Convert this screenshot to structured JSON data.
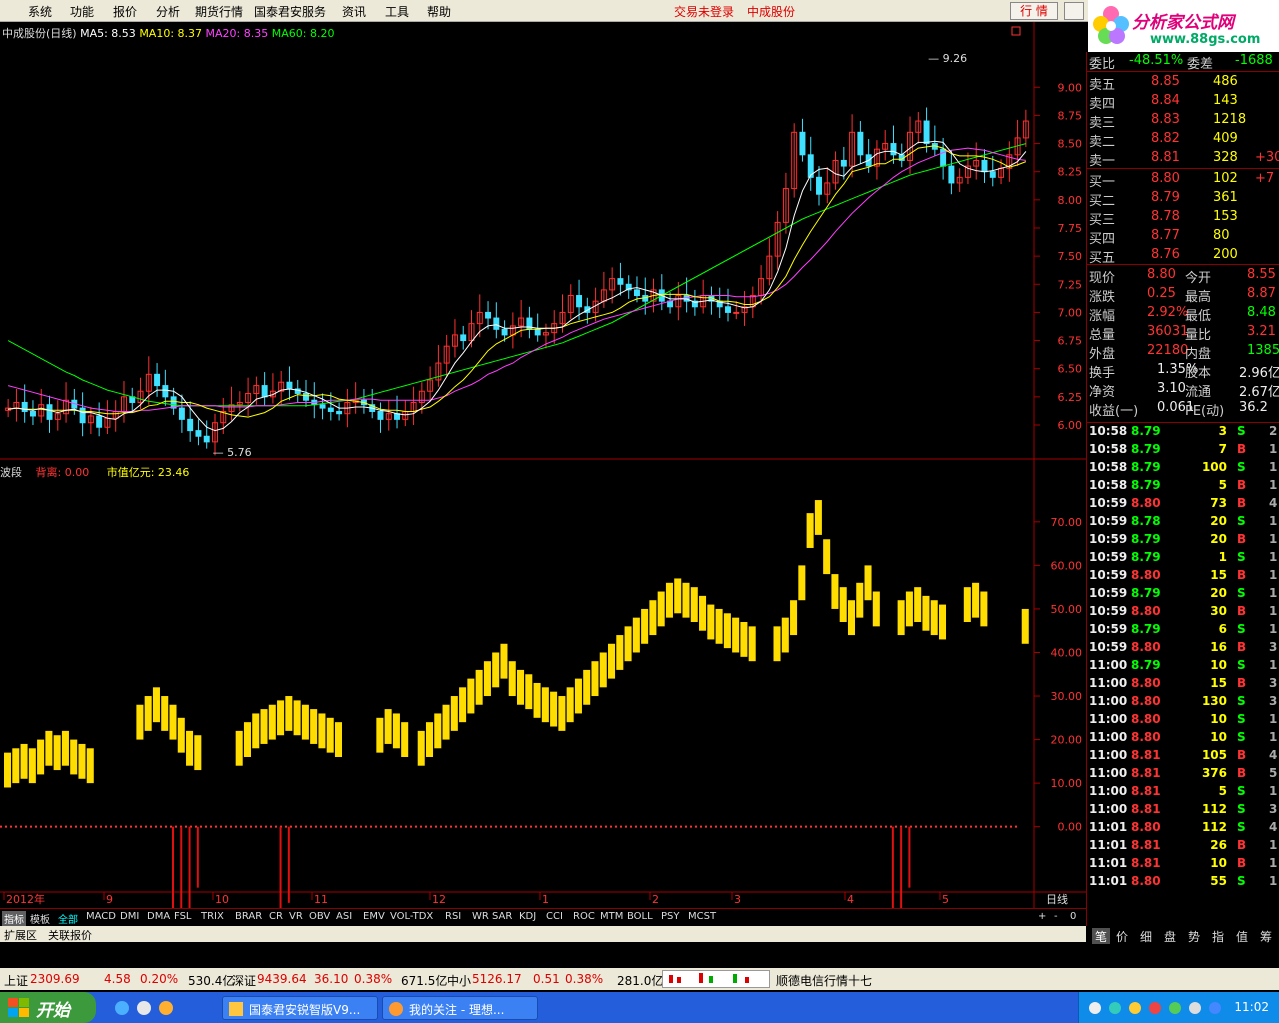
{
  "menu": {
    "items": [
      "系统",
      "功能",
      "报价",
      "分析",
      "期货行情",
      "国泰君安服务",
      "资讯",
      "工具",
      "帮助"
    ],
    "login_status": "交易未登录",
    "stock_name": "中成股份",
    "quote_button": "行 情"
  },
  "logo": {
    "text": "分析家公式网",
    "url": "www.88gs.com"
  },
  "main_chart": {
    "title": "中成股份(日线)",
    "ma5": "MA5: 8.53",
    "ma10": "MA10: 8.37",
    "ma20": "MA20: 8.35",
    "ma60": "MA60: 8.20",
    "high_label": "9.26",
    "low_label": "5.76"
  },
  "indicator": {
    "name": "波段",
    "item1": "背离: 0.00",
    "item2": "市值亿元: 23.46"
  },
  "colors": {
    "up": "#ff3030",
    "down": "#40e0ff",
    "ma5": "#ffffff",
    "ma10": "#ffff00",
    "ma20": "#ff40ff",
    "ma60": "#00ff00",
    "wave": "#ffdd00"
  },
  "chart_data": [
    {
      "type": "candlestick",
      "axis_ticks": [
        "9.00",
        "8.75",
        "8.50",
        "8.25",
        "8.00",
        "7.75",
        "7.50",
        "7.25",
        "7.00",
        "6.75",
        "6.50",
        "6.25",
        "6.00"
      ],
      "ylim": [
        5.76,
        9.26
      ],
      "x_labels": [
        "2012年",
        "9",
        "10",
        "11",
        "12",
        "1",
        "2",
        "3",
        "4",
        "5"
      ],
      "period": "日线",
      "close": [
        6.15,
        6.2,
        6.12,
        6.08,
        6.18,
        6.05,
        6.1,
        6.22,
        6.15,
        6.02,
        6.08,
        5.98,
        6.06,
        6.12,
        6.25,
        6.2,
        6.3,
        6.45,
        6.35,
        6.25,
        6.15,
        6.05,
        5.95,
        5.9,
        5.85,
        6.02,
        6.12,
        6.18,
        6.2,
        6.28,
        6.35,
        6.25,
        6.3,
        6.38,
        6.32,
        6.28,
        6.22,
        6.18,
        6.15,
        6.12,
        6.1,
        6.2,
        6.22,
        6.18,
        6.12,
        6.05,
        6.1,
        6.05,
        6.12,
        6.2,
        6.3,
        6.4,
        6.55,
        6.7,
        6.8,
        6.75,
        6.9,
        7.0,
        6.95,
        6.85,
        6.8,
        6.88,
        6.95,
        6.85,
        6.8,
        6.82,
        6.9,
        7.0,
        7.15,
        7.05,
        7.0,
        7.1,
        7.2,
        7.3,
        7.25,
        7.2,
        7.15,
        7.1,
        7.2,
        7.1,
        7.05,
        7.15,
        7.1,
        7.05,
        7.15,
        7.1,
        7.05,
        7.0,
        7.0,
        7.05,
        7.15,
        7.3,
        7.5,
        7.8,
        8.1,
        8.6,
        8.4,
        8.2,
        8.05,
        8.15,
        8.35,
        8.3,
        8.6,
        8.4,
        8.3,
        8.45,
        8.5,
        8.4,
        8.35,
        8.6,
        8.7,
        8.5,
        8.45,
        8.3,
        8.15,
        8.2,
        8.3,
        8.35,
        8.25,
        8.2,
        8.28,
        8.4,
        8.55,
        8.7
      ],
      "ma5": [
        6.14,
        6.15,
        6.14,
        6.13,
        6.15,
        6.13,
        6.11,
        6.13,
        6.14,
        6.11,
        6.11,
        6.09,
        6.06,
        6.05,
        6.1,
        6.12,
        6.18,
        6.26,
        6.31,
        6.31,
        6.3,
        6.25,
        6.15,
        6.06,
        5.98,
        5.95,
        5.97,
        6.03,
        6.11,
        6.16,
        6.23,
        6.25,
        6.27,
        6.31,
        6.32,
        6.31,
        6.29,
        6.26,
        6.23,
        6.19,
        6.15,
        6.15,
        6.16,
        6.16,
        6.15,
        6.13,
        6.12,
        6.1,
        6.09,
        6.1,
        6.15,
        6.21,
        6.31,
        6.43,
        6.55,
        6.64,
        6.74,
        6.83,
        6.88,
        6.89,
        6.86,
        6.86,
        6.87,
        6.87,
        6.86,
        6.86,
        6.86,
        6.87,
        6.93,
        6.98,
        7.02,
        7.06,
        7.1,
        7.13,
        7.17,
        7.21,
        7.22,
        7.2,
        7.18,
        7.15,
        7.12,
        7.12,
        7.12,
        7.09,
        7.1,
        7.11,
        7.09,
        7.08,
        7.06,
        7.04,
        7.05,
        7.1,
        7.2,
        7.36,
        7.57,
        7.86,
        8.08,
        8.22,
        8.27,
        8.28,
        8.23,
        8.21,
        8.29,
        8.32,
        8.35,
        8.41,
        8.43,
        8.43,
        8.4,
        8.46,
        8.51,
        8.51,
        8.52,
        8.51,
        8.42,
        8.32,
        8.28,
        8.26,
        8.25,
        8.26,
        8.28,
        8.3,
        8.34,
        8.43
      ],
      "ma10": [
        6.14,
        6.15,
        6.14,
        6.14,
        6.14,
        6.13,
        6.13,
        6.13,
        6.13,
        6.12,
        6.12,
        6.11,
        6.1,
        6.1,
        6.11,
        6.11,
        6.13,
        6.17,
        6.18,
        6.21,
        6.21,
        6.2,
        6.2,
        6.18,
        6.15,
        6.13,
        6.11,
        6.09,
        6.08,
        6.07,
        6.09,
        6.11,
        6.15,
        6.21,
        6.24,
        6.27,
        6.26,
        6.26,
        6.27,
        6.26,
        6.23,
        6.22,
        6.21,
        6.2,
        6.17,
        6.14,
        6.13,
        6.13,
        6.12,
        6.12,
        6.14,
        6.16,
        6.21,
        6.27,
        6.34,
        6.4,
        6.48,
        6.57,
        6.66,
        6.72,
        6.76,
        6.8,
        6.84,
        6.85,
        6.85,
        6.86,
        6.86,
        6.87,
        6.9,
        6.92,
        6.94,
        6.96,
        6.98,
        7.0,
        7.04,
        7.09,
        7.12,
        7.13,
        7.15,
        7.16,
        7.16,
        7.16,
        7.16,
        7.14,
        7.13,
        7.13,
        7.1,
        7.1,
        7.09,
        7.07,
        7.07,
        7.1,
        7.14,
        7.22,
        7.32,
        7.47,
        7.6,
        7.72,
        7.83,
        7.94,
        8.05,
        8.14,
        8.25,
        8.27,
        8.29,
        8.32,
        8.32,
        8.36,
        8.36,
        8.41,
        8.46,
        8.47,
        8.48,
        8.46,
        8.41,
        8.39,
        8.39,
        8.39,
        8.38,
        8.36,
        8.33,
        8.29,
        8.31,
        8.34
      ],
      "ma20": [
        6.35,
        6.33,
        6.31,
        6.29,
        6.27,
        6.25,
        6.23,
        6.21,
        6.19,
        6.17,
        6.15,
        6.14,
        6.13,
        6.12,
        6.12,
        6.12,
        6.13,
        6.13,
        6.14,
        6.15,
        6.16,
        6.17,
        6.17,
        6.17,
        6.17,
        6.17,
        6.16,
        6.16,
        6.16,
        6.16,
        6.17,
        6.17,
        6.17,
        6.18,
        6.19,
        6.2,
        6.2,
        6.2,
        6.21,
        6.22,
        6.22,
        6.22,
        6.23,
        6.23,
        6.23,
        6.22,
        6.22,
        6.22,
        6.22,
        6.22,
        6.22,
        6.22,
        6.24,
        6.26,
        6.3,
        6.33,
        6.36,
        6.4,
        6.45,
        6.48,
        6.52,
        6.55,
        6.6,
        6.64,
        6.68,
        6.72,
        6.75,
        6.78,
        6.82,
        6.85,
        6.88,
        6.91,
        6.94,
        6.96,
        6.98,
        7.0,
        7.02,
        7.04,
        7.06,
        7.08,
        7.1,
        7.12,
        7.13,
        7.14,
        7.15,
        7.15,
        7.15,
        7.15,
        7.14,
        7.14,
        7.14,
        7.15,
        7.17,
        7.2,
        7.25,
        7.32,
        7.4,
        7.47,
        7.55,
        7.63,
        7.72,
        7.8,
        7.88,
        7.95,
        8.02,
        8.08,
        8.14,
        8.2,
        8.25,
        8.29,
        8.33,
        8.36,
        8.39,
        8.42,
        8.44,
        8.45,
        8.46,
        8.45,
        8.44,
        8.42,
        8.4,
        8.38,
        8.36,
        8.35
      ],
      "ma60": [
        6.75,
        6.71,
        6.67,
        6.63,
        6.59,
        6.55,
        6.51,
        6.47,
        6.44,
        6.4,
        6.37,
        6.34,
        6.31,
        6.29,
        6.27,
        6.25,
        6.23,
        6.21,
        6.2,
        6.19,
        6.18,
        6.17,
        6.17,
        6.17,
        6.17,
        6.17,
        6.17,
        6.17,
        6.17,
        6.17,
        6.17,
        6.17,
        6.17,
        6.17,
        6.17,
        6.17,
        6.17,
        6.18,
        6.19,
        6.2,
        6.21,
        6.22,
        6.23,
        6.25,
        6.27,
        6.29,
        6.31,
        6.33,
        6.35,
        6.37,
        6.39,
        6.41,
        6.43,
        6.45,
        6.47,
        6.49,
        6.51,
        6.53,
        6.55,
        6.57,
        6.59,
        6.61,
        6.63,
        6.65,
        6.67,
        6.69,
        6.71,
        6.73,
        6.76,
        6.79,
        6.82,
        6.85,
        6.88,
        6.91,
        6.95,
        6.99,
        7.03,
        7.07,
        7.11,
        7.15,
        7.19,
        7.23,
        7.27,
        7.31,
        7.35,
        7.39,
        7.43,
        7.47,
        7.51,
        7.55,
        7.59,
        7.63,
        7.67,
        7.71,
        7.75,
        7.79,
        7.83,
        7.86,
        7.89,
        7.92,
        7.95,
        7.98,
        8.01,
        8.04,
        8.07,
        8.1,
        8.13,
        8.16,
        8.19,
        8.22,
        8.24,
        8.26,
        8.28,
        8.3,
        8.32,
        8.34,
        8.36,
        8.38,
        8.4,
        8.42,
        8.44,
        8.46,
        8.48,
        8.5
      ]
    },
    {
      "type": "bar",
      "name": "波段",
      "axis_ticks": [
        "70.00",
        "60.00",
        "50.00",
        "40.00",
        "30.00",
        "20.00",
        "10.00",
        "0.00"
      ],
      "ylim": [
        -15,
        78
      ],
      "values": [
        17,
        18,
        19,
        18,
        20,
        22,
        21,
        22,
        20,
        19,
        18,
        0,
        0,
        0,
        0,
        0,
        28,
        30,
        32,
        30,
        28,
        25,
        22,
        21,
        0,
        0,
        0,
        0,
        22,
        24,
        26,
        27,
        28,
        29,
        30,
        29,
        28,
        27,
        26,
        25,
        24,
        0,
        0,
        0,
        0,
        25,
        27,
        26,
        24,
        0,
        22,
        24,
        26,
        28,
        30,
        32,
        34,
        36,
        38,
        40,
        42,
        38,
        36,
        35,
        33,
        32,
        31,
        30,
        32,
        34,
        36,
        38,
        40,
        42,
        44,
        46,
        48,
        50,
        52,
        54,
        56,
        57,
        56,
        55,
        53,
        51,
        50,
        49,
        48,
        47,
        46,
        0,
        0,
        46,
        48,
        52,
        60,
        72,
        75,
        66,
        58,
        55,
        52,
        56,
        60,
        54,
        0,
        0,
        52,
        54,
        55,
        53,
        52,
        51,
        0,
        0,
        55,
        56,
        54,
        0,
        0,
        0,
        0,
        50
      ],
      "negative": [
        0,
        0,
        0,
        0,
        0,
        0,
        0,
        0,
        0,
        0,
        0,
        0,
        0,
        0,
        0,
        0,
        0,
        0,
        0,
        0,
        -8,
        -12,
        -7,
        -4,
        0,
        0,
        0,
        0,
        0,
        0,
        0,
        0,
        0,
        -10,
        -5,
        0,
        0,
        0,
        0,
        0,
        0,
        0,
        0,
        0,
        0,
        0,
        0,
        0,
        0,
        0,
        0,
        0,
        0,
        0,
        0,
        0,
        0,
        0,
        0,
        0,
        0,
        0,
        0,
        0,
        0,
        0,
        0,
        0,
        0,
        0,
        0,
        0,
        0,
        0,
        0,
        0,
        0,
        0,
        0,
        0,
        0,
        0,
        0,
        0,
        0,
        0,
        0,
        0,
        0,
        0,
        0,
        0,
        0,
        0,
        0,
        0,
        0,
        0,
        0,
        0,
        0,
        0,
        0,
        0,
        0,
        0,
        0,
        -6,
        -10,
        -4,
        0,
        0,
        0,
        0,
        0,
        0,
        0,
        0,
        0,
        0,
        0,
        0,
        0,
        0
      ]
    }
  ],
  "quote": {
    "top": {
      "label": "委比",
      "value": "-48.51%",
      "label2": "委差",
      "value2": "-1688"
    },
    "sell": [
      {
        "label": "卖五",
        "price": "8.85",
        "vol": "486",
        "chg": ""
      },
      {
        "label": "卖四",
        "price": "8.84",
        "vol": "143",
        "chg": ""
      },
      {
        "label": "卖三",
        "price": "8.83",
        "vol": "1218",
        "chg": ""
      },
      {
        "label": "卖二",
        "price": "8.82",
        "vol": "409",
        "chg": ""
      },
      {
        "label": "卖一",
        "price": "8.81",
        "vol": "328",
        "chg": "+30"
      }
    ],
    "buy": [
      {
        "label": "买一",
        "price": "8.80",
        "vol": "102",
        "chg": "+7"
      },
      {
        "label": "买二",
        "price": "8.79",
        "vol": "361",
        "chg": ""
      },
      {
        "label": "买三",
        "price": "8.78",
        "vol": "153",
        "chg": ""
      },
      {
        "label": "买四",
        "price": "8.77",
        "vol": "80",
        "chg": ""
      },
      {
        "label": "买五",
        "price": "8.76",
        "vol": "200",
        "chg": ""
      }
    ],
    "stats": [
      {
        "l1": "现价",
        "v1": "8.80",
        "l2": "今开",
        "v2": "8.55"
      },
      {
        "l1": "涨跌",
        "v1": "0.25",
        "l2": "最高",
        "v2": "8.87"
      },
      {
        "l1": "涨幅",
        "v1": "2.92%",
        "l2": "最低",
        "v2": "8.48"
      },
      {
        "l1": "总量",
        "v1": "36031",
        "l2": "量比",
        "v2": "3.21"
      },
      {
        "l1": "外盘",
        "v1": "22180",
        "l2": "内盘",
        "v2": "13851"
      },
      {
        "l1": "换手",
        "v1": "1.35%",
        "l2": "股本",
        "v2": "2.96亿"
      },
      {
        "l1": "净资",
        "v1": "3.10",
        "l2": "流通",
        "v2": "2.67亿"
      },
      {
        "l1": "收益(一)",
        "v1": "0.061",
        "l2": "PE(动)",
        "v2": "36.2"
      }
    ]
  },
  "ticks": [
    [
      "10:58",
      "8.79",
      "3",
      "S",
      "2"
    ],
    [
      "10:58",
      "8.79",
      "7",
      "B",
      "1"
    ],
    [
      "10:58",
      "8.79",
      "100",
      "S",
      "1"
    ],
    [
      "10:58",
      "8.79",
      "5",
      "B",
      "1"
    ],
    [
      "10:59",
      "8.80",
      "73",
      "B",
      "4"
    ],
    [
      "10:59",
      "8.78",
      "20",
      "S",
      "1"
    ],
    [
      "10:59",
      "8.79",
      "20",
      "B",
      "1"
    ],
    [
      "10:59",
      "8.79",
      "1",
      "S",
      "1"
    ],
    [
      "10:59",
      "8.80",
      "15",
      "B",
      "1"
    ],
    [
      "10:59",
      "8.79",
      "20",
      "S",
      "1"
    ],
    [
      "10:59",
      "8.80",
      "30",
      "B",
      "1"
    ],
    [
      "10:59",
      "8.79",
      "6",
      "S",
      "1"
    ],
    [
      "10:59",
      "8.80",
      "16",
      "B",
      "3"
    ],
    [
      "11:00",
      "8.79",
      "10",
      "S",
      "1"
    ],
    [
      "11:00",
      "8.80",
      "15",
      "B",
      "3"
    ],
    [
      "11:00",
      "8.80",
      "130",
      "S",
      "3"
    ],
    [
      "11:00",
      "8.80",
      "10",
      "S",
      "1"
    ],
    [
      "11:00",
      "8.80",
      "10",
      "S",
      "1"
    ],
    [
      "11:00",
      "8.81",
      "105",
      "B",
      "4"
    ],
    [
      "11:00",
      "8.81",
      "376",
      "B",
      "5"
    ],
    [
      "11:00",
      "8.81",
      "5",
      "S",
      "1"
    ],
    [
      "11:00",
      "8.81",
      "112",
      "S",
      "3"
    ],
    [
      "11:01",
      "8.80",
      "112",
      "S",
      "4"
    ],
    [
      "11:01",
      "8.81",
      "26",
      "B",
      "1"
    ],
    [
      "11:01",
      "8.81",
      "10",
      "B",
      "1"
    ],
    [
      "11:01",
      "8.80",
      "55",
      "S",
      "1"
    ]
  ],
  "tabs": [
    "指标",
    "模板",
    "全部",
    "MACD",
    "DMI",
    "DMA",
    "FSL",
    "TRIX",
    "BRAR",
    "CR",
    "VR",
    "OBV",
    "ASI",
    "EMV",
    "VOL-TDX",
    "RSI",
    "WR",
    "SAR",
    "KDJ",
    "CCI",
    "ROC",
    "MTM",
    "BOLL",
    "PSY",
    "MCST"
  ],
  "bottom_tabs": [
    "扩展区",
    "关联报价"
  ],
  "panel_tabs": [
    "笔",
    "价",
    "细",
    "盘",
    "势",
    "指",
    "值",
    "筹"
  ],
  "index_bar": {
    "sh_name": "上证",
    "sh_val": "2309.69",
    "sh_chg": "4.58",
    "sh_pct": "0.20%",
    "sh_amt": "530.4亿",
    "sz_name": "深证",
    "sz_val": "9439.64",
    "sz_chg": "36.10",
    "sz_pct": "0.38%",
    "sz_amt": "671.5亿",
    "zx_name": "中小",
    "zx_val": "5126.17",
    "zx_chg": "0.51",
    "zx_pct": "0.38%",
    "zx_amt": "281.0亿",
    "marquee": "顺德电信行情十七"
  },
  "taskbar": {
    "start": "开始",
    "task1": "国泰君安锐智版V9...",
    "task2": "我的关注 - 理想...",
    "clock": "11:02"
  }
}
